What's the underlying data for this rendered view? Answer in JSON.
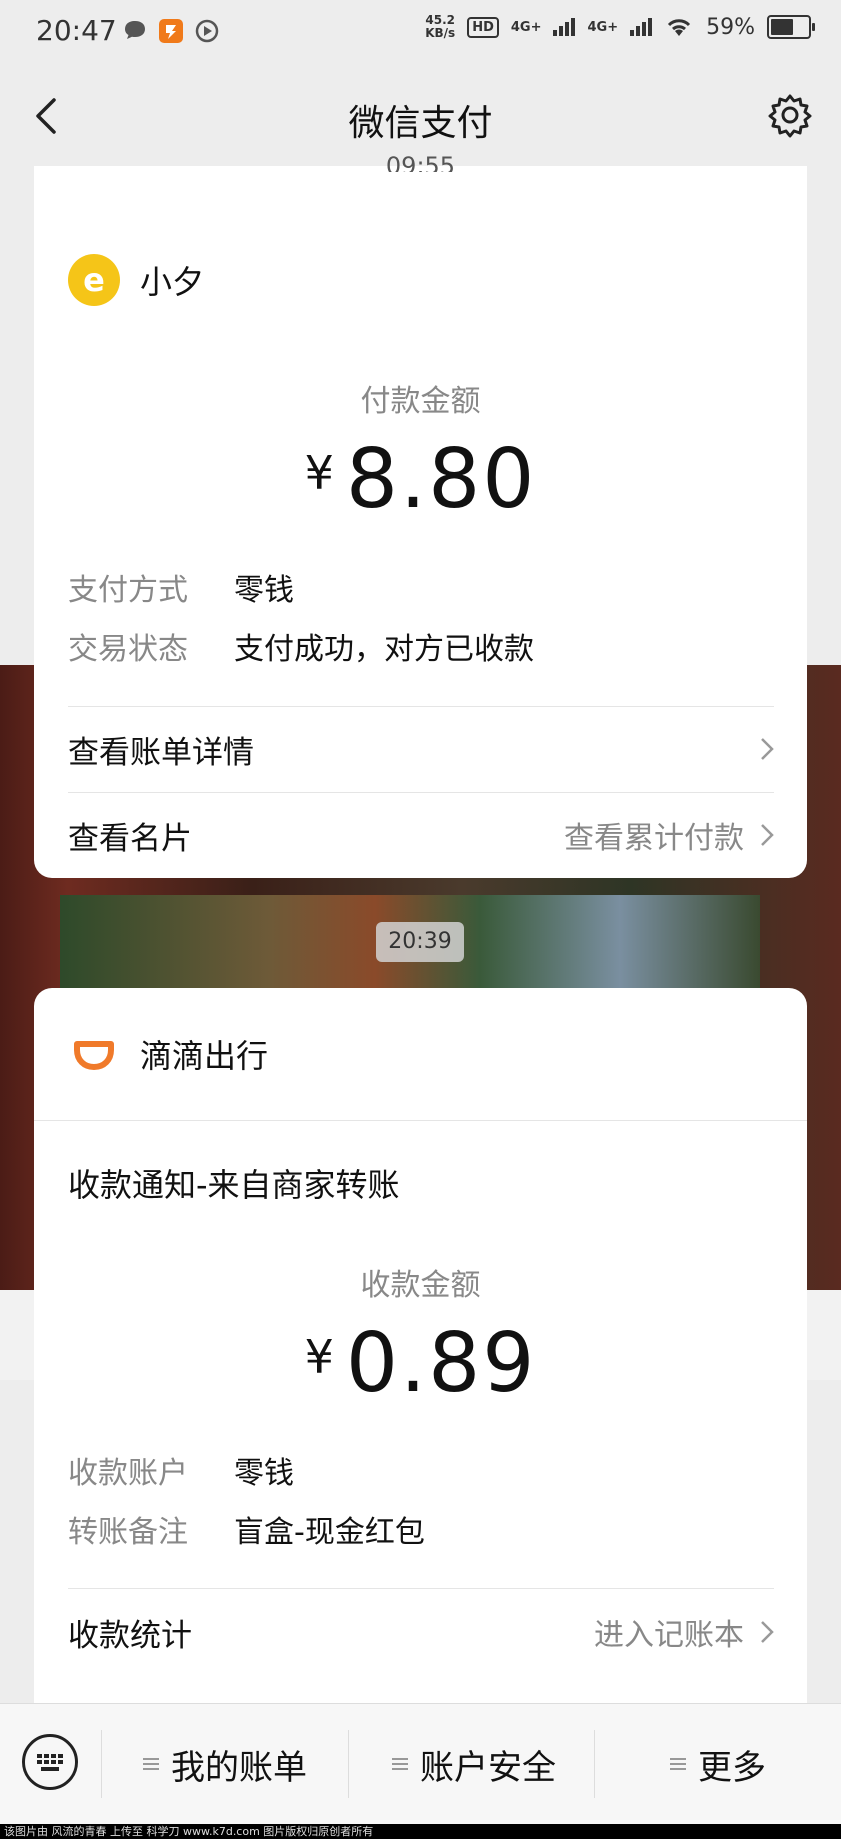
{
  "status_bar": {
    "time": "20:47",
    "speed": "45.2",
    "speed_unit": "KB/s",
    "hd_badge": "HD",
    "net1": "4G+",
    "net2": "4G+",
    "battery": "59%"
  },
  "nav": {
    "title": "微信支付"
  },
  "top_timestamp": "09:55",
  "payment": {
    "merchant": "小夕",
    "amount_label": "付款金额",
    "currency": "¥",
    "amount": "8.80",
    "fields": [
      {
        "k": "支付方式",
        "v": "零钱"
      },
      {
        "k": "交易状态",
        "v": "支付成功，对方已收款"
      }
    ],
    "link_bill": "查看账单详情",
    "link_card": "查看名片",
    "link_card_right": "查看累计付款"
  },
  "time_pill": "20:39",
  "receipt": {
    "merchant": "滴滴出行",
    "title": "收款通知-来自商家转账",
    "amount_label": "收款金额",
    "currency": "¥",
    "amount": "0.89",
    "fields": [
      {
        "k": "收款账户",
        "v": "零钱"
      },
      {
        "k": "转账备注",
        "v": "盲盒-现金红包"
      }
    ],
    "stats_label": "收款统计",
    "stats_right": "进入记账本"
  },
  "bottom_bar": {
    "item1": "我的账单",
    "item2": "账户安全",
    "item3": "更多"
  },
  "footer": "该图片由 风流的青春 上传至 科学刀 www.k7d.com 图片版权归原创者所有"
}
